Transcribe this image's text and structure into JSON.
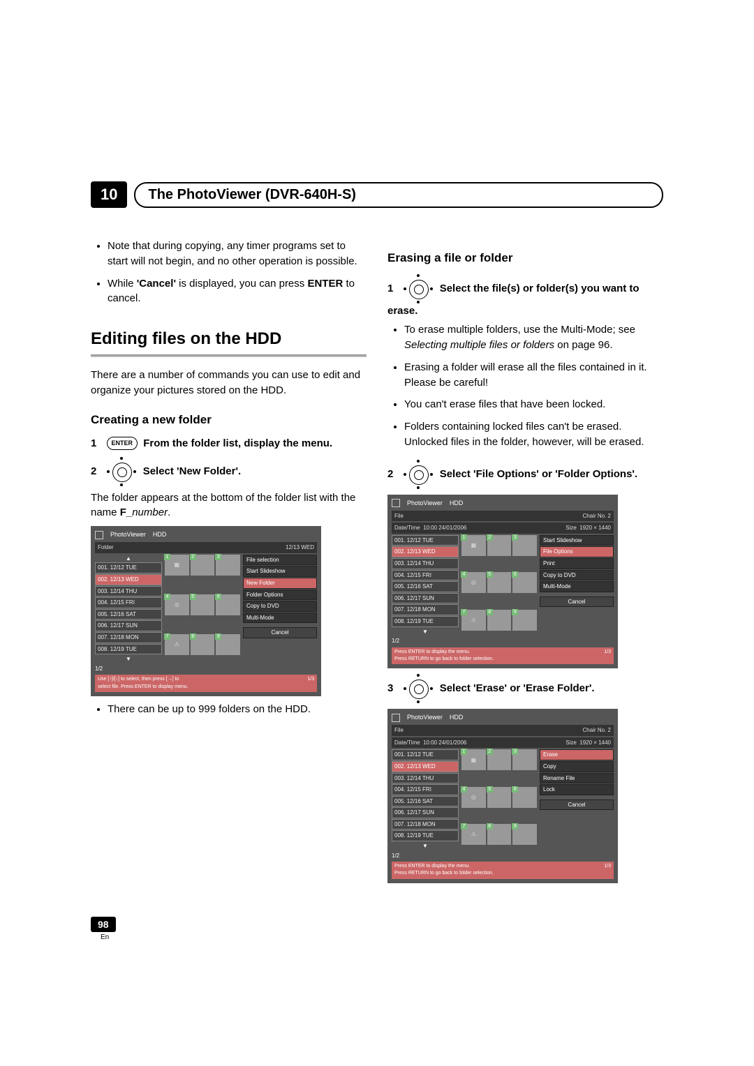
{
  "chapter": {
    "number": "10",
    "title": "The PhotoViewer (DVR-640H-S)"
  },
  "leftCol": {
    "bullets1": [
      "Note that during copying, any timer programs set to start will not begin, and no other operation is possible."
    ],
    "bullet2_pre": "While ",
    "bullet2_cancel": "'Cancel'",
    "bullet2_mid": " is displayed, you can press ",
    "bullet2_enter": "ENTER",
    "bullet2_post": " to cancel.",
    "h2": "Editing files on the HDD",
    "intro": "There are a number of commands you can use to edit and organize your pictures stored on the HDD.",
    "h3_create": "Creating a new folder",
    "step1_bold": "From the folder list, display the menu.",
    "step2_bold": "Select 'New Folder'.",
    "step2_body_pre": "The folder appears at the bottom of the folder list with the name ",
    "step2_body_F": "F_",
    "step2_body_number": "number",
    "step2_body_post": ".",
    "after_ss_bullet": "There can be up to 999 folders on the HDD."
  },
  "rightCol": {
    "h3_erase": "Erasing a file or folder",
    "step1_bold": "Select the file(s) or folder(s) you want to erase.",
    "er_b1_pre": "To erase multiple folders, use the Multi-Mode; see ",
    "er_b1_ital": "Selecting multiple files or folders",
    "er_b1_post": " on page 96.",
    "er_b2": "Erasing a folder will erase all the files contained in it. Please be careful!",
    "er_b3": "You can't erase files that have been locked.",
    "er_b4": "Folders containing locked files can't be erased. Unlocked files in the folder, however, will be erased.",
    "step2_bold": "Select 'File Options' or 'Folder Options'.",
    "step3_bold": "Select 'Erase' or 'Erase Folder'."
  },
  "enterLabel": "ENTER",
  "ss1": {
    "app": "PhotoViewer",
    "src": "HDD",
    "row2_left": "Folder",
    "row2_right": "12/13 WED",
    "list": [
      "001. 12/12 TUE",
      "002. 12/13 WED",
      "003. 12/14 THU",
      "004. 12/15 FRI",
      "005. 12/16 SAT",
      "006. 12/17 SUN",
      "007. 12/18 MON",
      "008. 12/19 TUE"
    ],
    "selIndex": 1,
    "pager": "1/2",
    "menu": [
      "File selection",
      "Start Slideshow",
      "New Folder",
      "Folder Options",
      "Copy to DVD",
      "Multi-Mode",
      "Cancel"
    ],
    "menuSel": 2,
    "footer1": "Use [↑]/[↓] to select, then press [→] to",
    "footer2": "select file. Press ENTER to display menu.",
    "footerR": "1/3"
  },
  "ss2": {
    "app": "PhotoViewer",
    "src": "HDD",
    "row2a_l": "File",
    "row2a_r": "Chair No. 2",
    "row2b_l": "Date/Time",
    "row2b_m": "10:00 24/01/2006",
    "row2b_r_l": "Size",
    "row2b_r_r": "1920 × 1440",
    "list": [
      "001. 12/12 TUE",
      "002. 12/13 WED",
      "003. 12/14 THU",
      "004. 12/15 FRI",
      "005. 12/16 SAT",
      "006. 12/17 SUN",
      "007. 12/18 MON",
      "008. 12/19 TUE"
    ],
    "selIndex": 1,
    "pager": "1/2",
    "menu": [
      "Start Slideshow",
      "File Options",
      "Print",
      "Copy to DVD",
      "Multi-Mode",
      "Cancel"
    ],
    "menuSel": 1,
    "footer1": "Press ENTER to display the menu.",
    "footer2": "Press RETURN to go back to folder selection.",
    "footerR": "1/3"
  },
  "ss3": {
    "app": "PhotoViewer",
    "src": "HDD",
    "row2a_l": "File",
    "row2a_r": "Chair No. 2",
    "row2b_l": "Date/Time",
    "row2b_m": "10:00 24/01/2006",
    "row2b_r_l": "Size",
    "row2b_r_r": "1920 × 1440",
    "list": [
      "001. 12/12 TUE",
      "002. 12/13 WED",
      "003. 12/14 THU",
      "004. 12/15 FRI",
      "005. 12/16 SAT",
      "006. 12/17 SUN",
      "007. 12/18 MON",
      "008. 12/19 TUE"
    ],
    "selIndex": 1,
    "pager": "1/2",
    "menu": [
      "Erase",
      "Copy",
      "Rename File",
      "Lock",
      "Cancel"
    ],
    "menuSel": 0,
    "footer1": "Press ENTER to display the menu.",
    "footer2": "Press RETURN to go back to folder selection.",
    "footerR": "1/3"
  },
  "pageNumber": "98",
  "lang": "En"
}
